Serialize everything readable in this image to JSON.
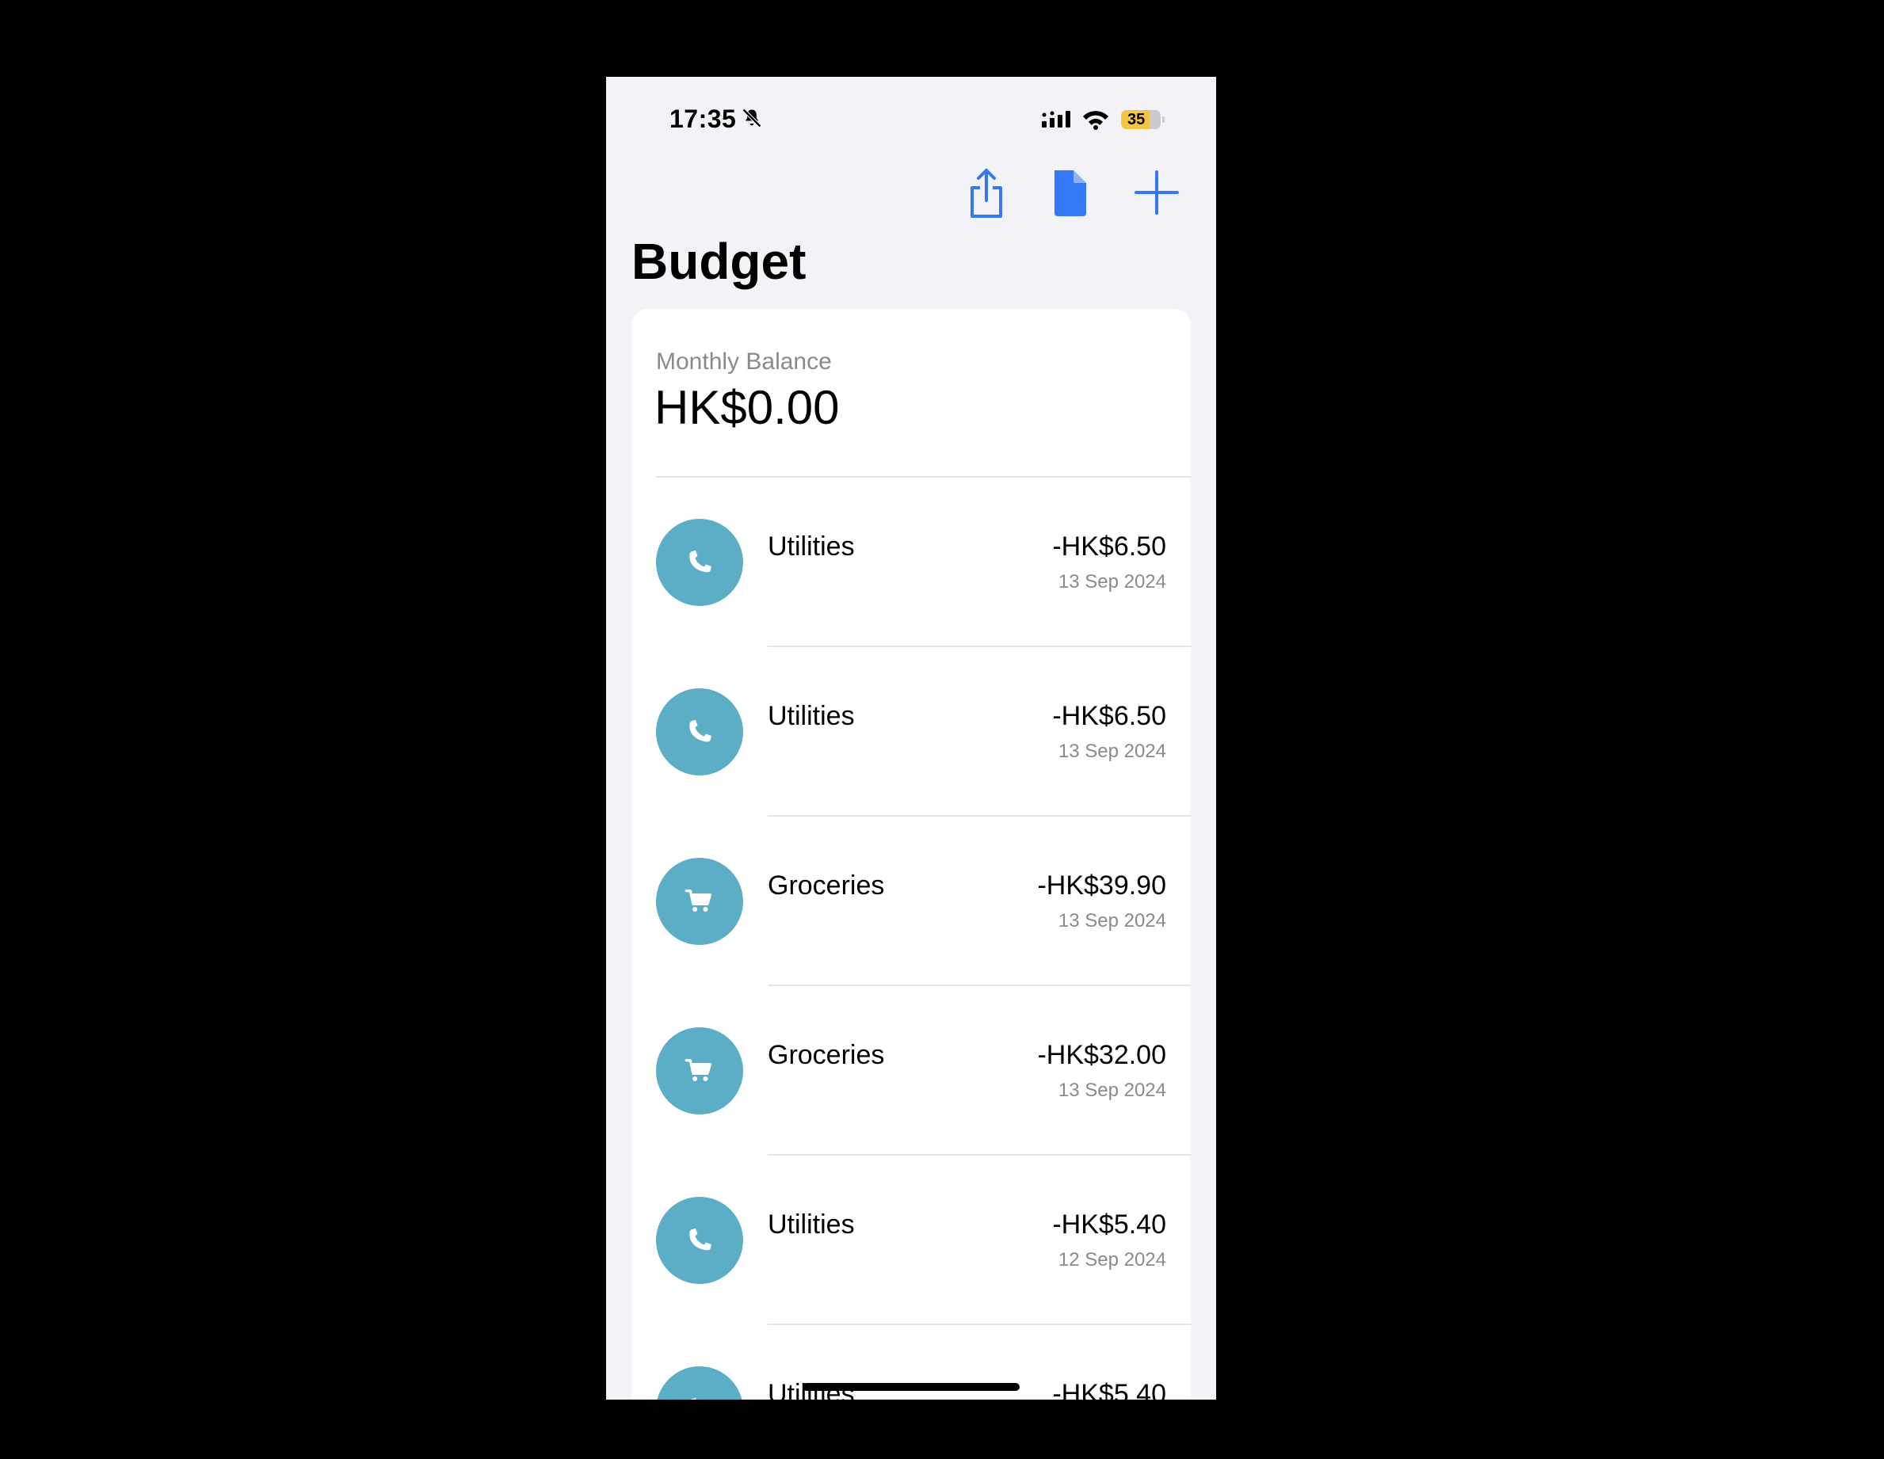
{
  "status_bar": {
    "time": "17:35",
    "battery": "35",
    "icons": [
      "bell-slash-icon",
      "signal-icon",
      "wifi-icon",
      "battery-icon"
    ]
  },
  "toolbar": {
    "icons": [
      "share-icon",
      "document-icon",
      "plus-icon"
    ],
    "accent_color": "#3478F6"
  },
  "header": {
    "title": "Budget"
  },
  "balance": {
    "label": "Monthly Balance",
    "value": "HK$0.00"
  },
  "transactions": [
    {
      "category": "Utilities",
      "amount": "-HK$6.50",
      "date": "13 Sep 2024",
      "icon": "phone-icon"
    },
    {
      "category": "Utilities",
      "amount": "-HK$6.50",
      "date": "13 Sep 2024",
      "icon": "phone-icon"
    },
    {
      "category": "Groceries",
      "amount": "-HK$39.90",
      "date": "13 Sep 2024",
      "icon": "cart-icon"
    },
    {
      "category": "Groceries",
      "amount": "-HK$32.00",
      "date": "13 Sep 2024",
      "icon": "cart-icon"
    },
    {
      "category": "Utilities",
      "amount": "-HK$5.40",
      "date": "12 Sep 2024",
      "icon": "phone-icon"
    },
    {
      "category": "Utilities",
      "amount": "-HK$5.40",
      "date": "",
      "icon": "phone-icon"
    }
  ],
  "colors": {
    "background": "#F2F2F7",
    "card": "#FFFFFF",
    "category_circle": "#5BAEC5",
    "secondary_text": "#8A8A8E"
  }
}
